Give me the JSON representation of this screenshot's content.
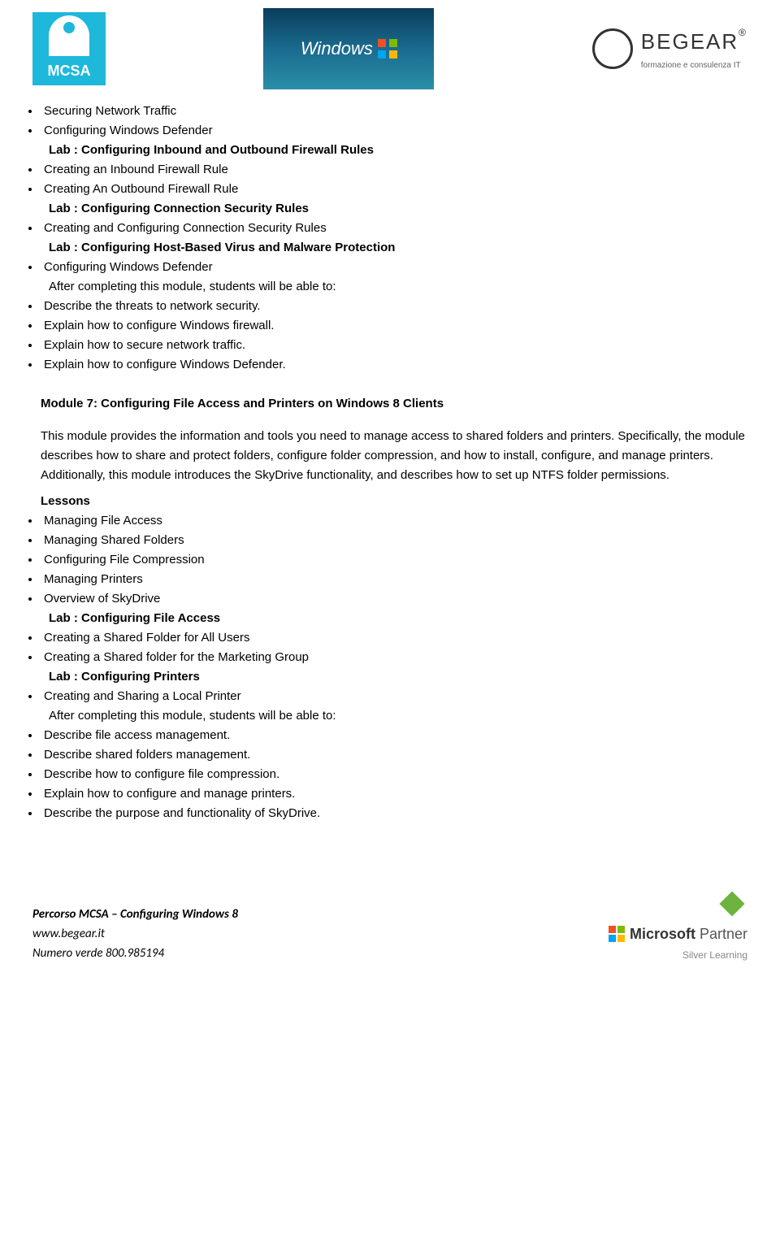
{
  "header": {
    "mcsa": "MCSA",
    "windows": "Windows",
    "begear_title": "BEGEAR",
    "begear_subtitle": "formazione e consulenza IT"
  },
  "section6": {
    "bullets1": [
      "Securing Network Traffic",
      "Configuring Windows Defender"
    ],
    "lab1": "Lab : Configuring Inbound and Outbound Firewall Rules",
    "bullets2": [
      "Creating an Inbound Firewall Rule",
      "Creating An Outbound Firewall Rule"
    ],
    "lab2": "Lab : Configuring Connection Security Rules",
    "bullets3": [
      "Creating and Configuring Connection Security Rules"
    ],
    "lab3": "Lab : Configuring Host-Based Virus and Malware Protection",
    "bullets4": [
      "Configuring Windows Defender"
    ],
    "after": "After completing this module, students will be able to:",
    "outcomes": [
      "Describe the threats to network security.",
      "Explain how to configure Windows firewall.",
      "Explain how to secure network traffic.",
      "Explain how to configure Windows Defender."
    ]
  },
  "module7": {
    "heading": "Module 7: Configuring File Access and Printers on Windows 8 Clients",
    "description": "This module provides the information and tools you need to manage access to shared folders and printers. Specifically, the module describes how to share and protect folders, configure folder compression, and how to install, configure, and manage printers. Additionally, this module introduces the SkyDrive functionality, and describes how to set up NTFS folder permissions.",
    "lessons_label": "Lessons",
    "lessons": [
      "Managing File Access",
      "Managing Shared Folders",
      "Configuring File Compression",
      "Managing Printers",
      "Overview of SkyDrive"
    ],
    "lab1": "Lab : Configuring File Access",
    "lab1_items": [
      "Creating a Shared Folder for All Users",
      "Creating a Shared folder for the Marketing Group"
    ],
    "lab2": "Lab : Configuring Printers",
    "lab2_items": [
      "Creating and Sharing a Local Printer"
    ],
    "after": "After completing this module, students will be able to:",
    "outcomes": [
      "Describe file access management.",
      "Describe shared folders management.",
      "Describe how to configure file compression.",
      "Explain how to configure and manage printers.",
      "Describe the purpose and functionality of SkyDrive."
    ]
  },
  "footer": {
    "line1": "Percorso MCSA – Configuring Windows 8",
    "line2": "www.begear.it",
    "line3": "Numero verde 800.985194",
    "ms_bold": "Microsoft",
    "ms_light": " Partner",
    "silver": "Silver Learning"
  }
}
